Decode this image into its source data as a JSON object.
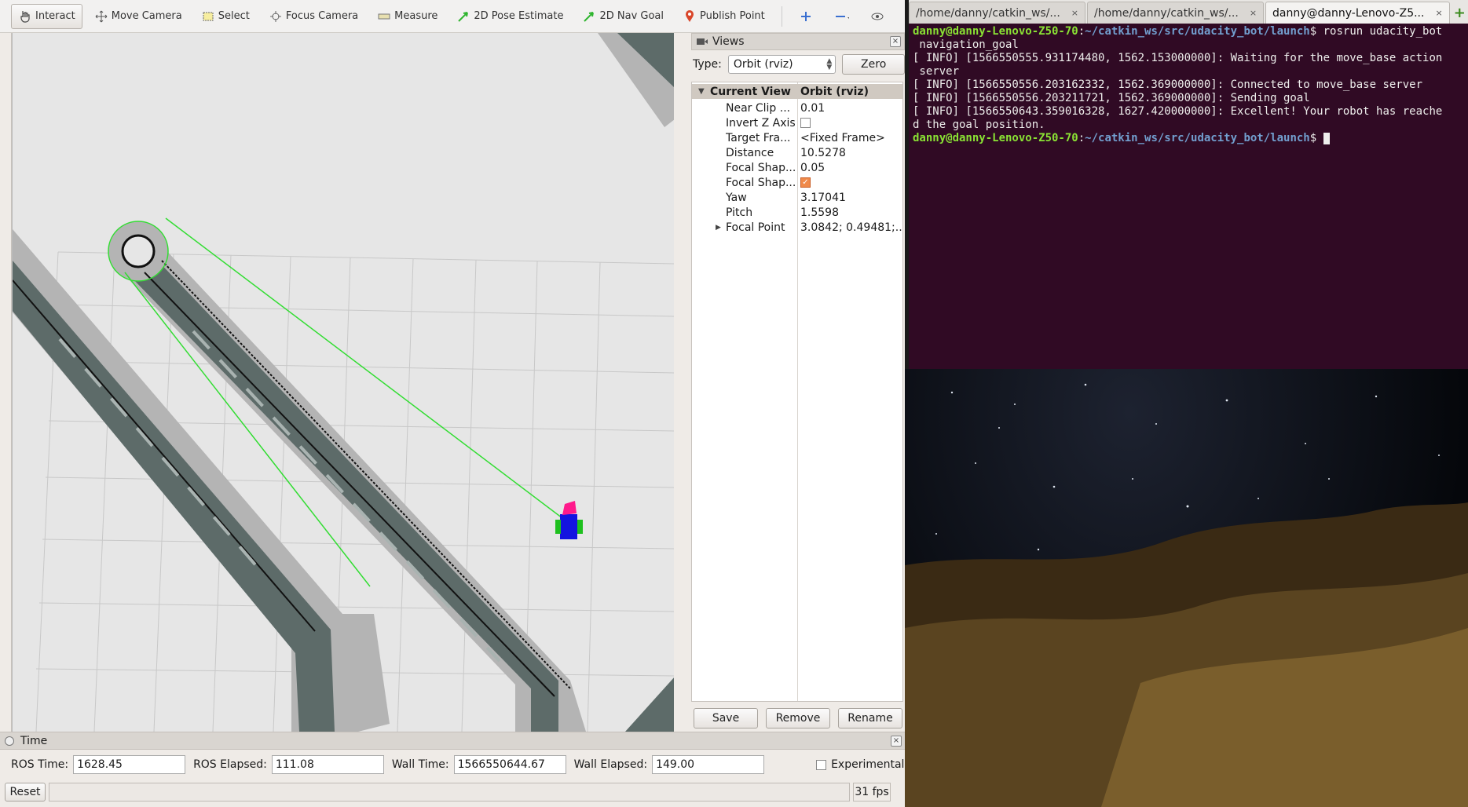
{
  "rviz": {
    "toolbar": [
      {
        "key": "interact",
        "label": "Interact",
        "icon": "hand-cursor-icon"
      },
      {
        "key": "move-camera",
        "label": "Move Camera",
        "icon": "move-camera-icon"
      },
      {
        "key": "select",
        "label": "Select",
        "icon": "select-box-icon"
      },
      {
        "key": "focus-camera",
        "label": "Focus Camera",
        "icon": "focus-camera-icon"
      },
      {
        "key": "measure",
        "label": "Measure",
        "icon": "ruler-icon"
      },
      {
        "key": "2d-pose-estimate",
        "label": "2D Pose Estimate",
        "icon": "green-arrow-icon"
      },
      {
        "key": "2d-nav-goal",
        "label": "2D Nav Goal",
        "icon": "green-arrow-icon"
      },
      {
        "key": "publish-point",
        "label": "Publish Point",
        "icon": "map-pin-icon"
      }
    ],
    "views": {
      "title": "Views",
      "type_label": "Type:",
      "type_value": "Orbit (rviz)",
      "zero_label": "Zero",
      "header_name": "Current View",
      "header_value": "Orbit (rviz)",
      "props": [
        {
          "name": "Near Clip ...",
          "value": "0.01",
          "kind": "text"
        },
        {
          "name": "Invert Z Axis",
          "value": "",
          "kind": "check-off"
        },
        {
          "name": "Target Fra...",
          "value": "<Fixed Frame>",
          "kind": "text"
        },
        {
          "name": "Distance",
          "value": "10.5278",
          "kind": "text"
        },
        {
          "name": "Focal Shap...",
          "value": "0.05",
          "kind": "text"
        },
        {
          "name": "Focal Shap...",
          "value": "",
          "kind": "check-on"
        },
        {
          "name": "Yaw",
          "value": "3.17041",
          "kind": "text"
        },
        {
          "name": "Pitch",
          "value": "1.5598",
          "kind": "text"
        },
        {
          "name": "Focal Point",
          "value": "3.0842; 0.49481;...",
          "kind": "expand"
        }
      ],
      "save_label": "Save",
      "remove_label": "Remove",
      "rename_label": "Rename"
    },
    "time": {
      "title": "Time",
      "ros_time_label": "ROS Time:",
      "ros_time": "1628.45",
      "ros_elapsed_label": "ROS Elapsed:",
      "ros_elapsed": "111.08",
      "wall_time_label": "Wall Time:",
      "wall_time": "1566550644.67",
      "wall_elapsed_label": "Wall Elapsed:",
      "wall_elapsed": "149.00",
      "experimental_label": "Experimental",
      "reset_label": "Reset",
      "fps": "31 fps"
    }
  },
  "terminal": {
    "tabs": [
      {
        "label": "/home/danny/catkin_ws/...",
        "active": false
      },
      {
        "label": "/home/danny/catkin_ws/...",
        "active": false
      },
      {
        "label": "danny@danny-Lenovo-Z5...",
        "active": true
      }
    ],
    "prompt_user": "danny@danny-Lenovo-Z50-70",
    "prompt_path": "~/catkin_ws/src/udacity_bot/launch",
    "command": " rosrun udacity_bot",
    "lines": [
      " navigation_goal",
      "[ INFO] [1566550555.931174480, 1562.153000000]: Waiting for the move_base action",
      " server",
      "[ INFO] [1566550556.203162332, 1562.369000000]: Connected to move_base server",
      "[ INFO] [1566550556.203211721, 1562.369000000]: Sending goal",
      "[ INFO] [1566550643.359016328, 1627.420000000]: Excellent! Your robot has reache",
      "d the goal position."
    ]
  },
  "colors": {
    "terminal_bg": "#300a24",
    "prompt_user": "#8ae234",
    "prompt_path": "#729fcf",
    "map_free": "#e6e6e6",
    "map_inflation": "#b4b4b4",
    "map_corridor": "#5d6b69",
    "plan_line": "#33dd33"
  }
}
